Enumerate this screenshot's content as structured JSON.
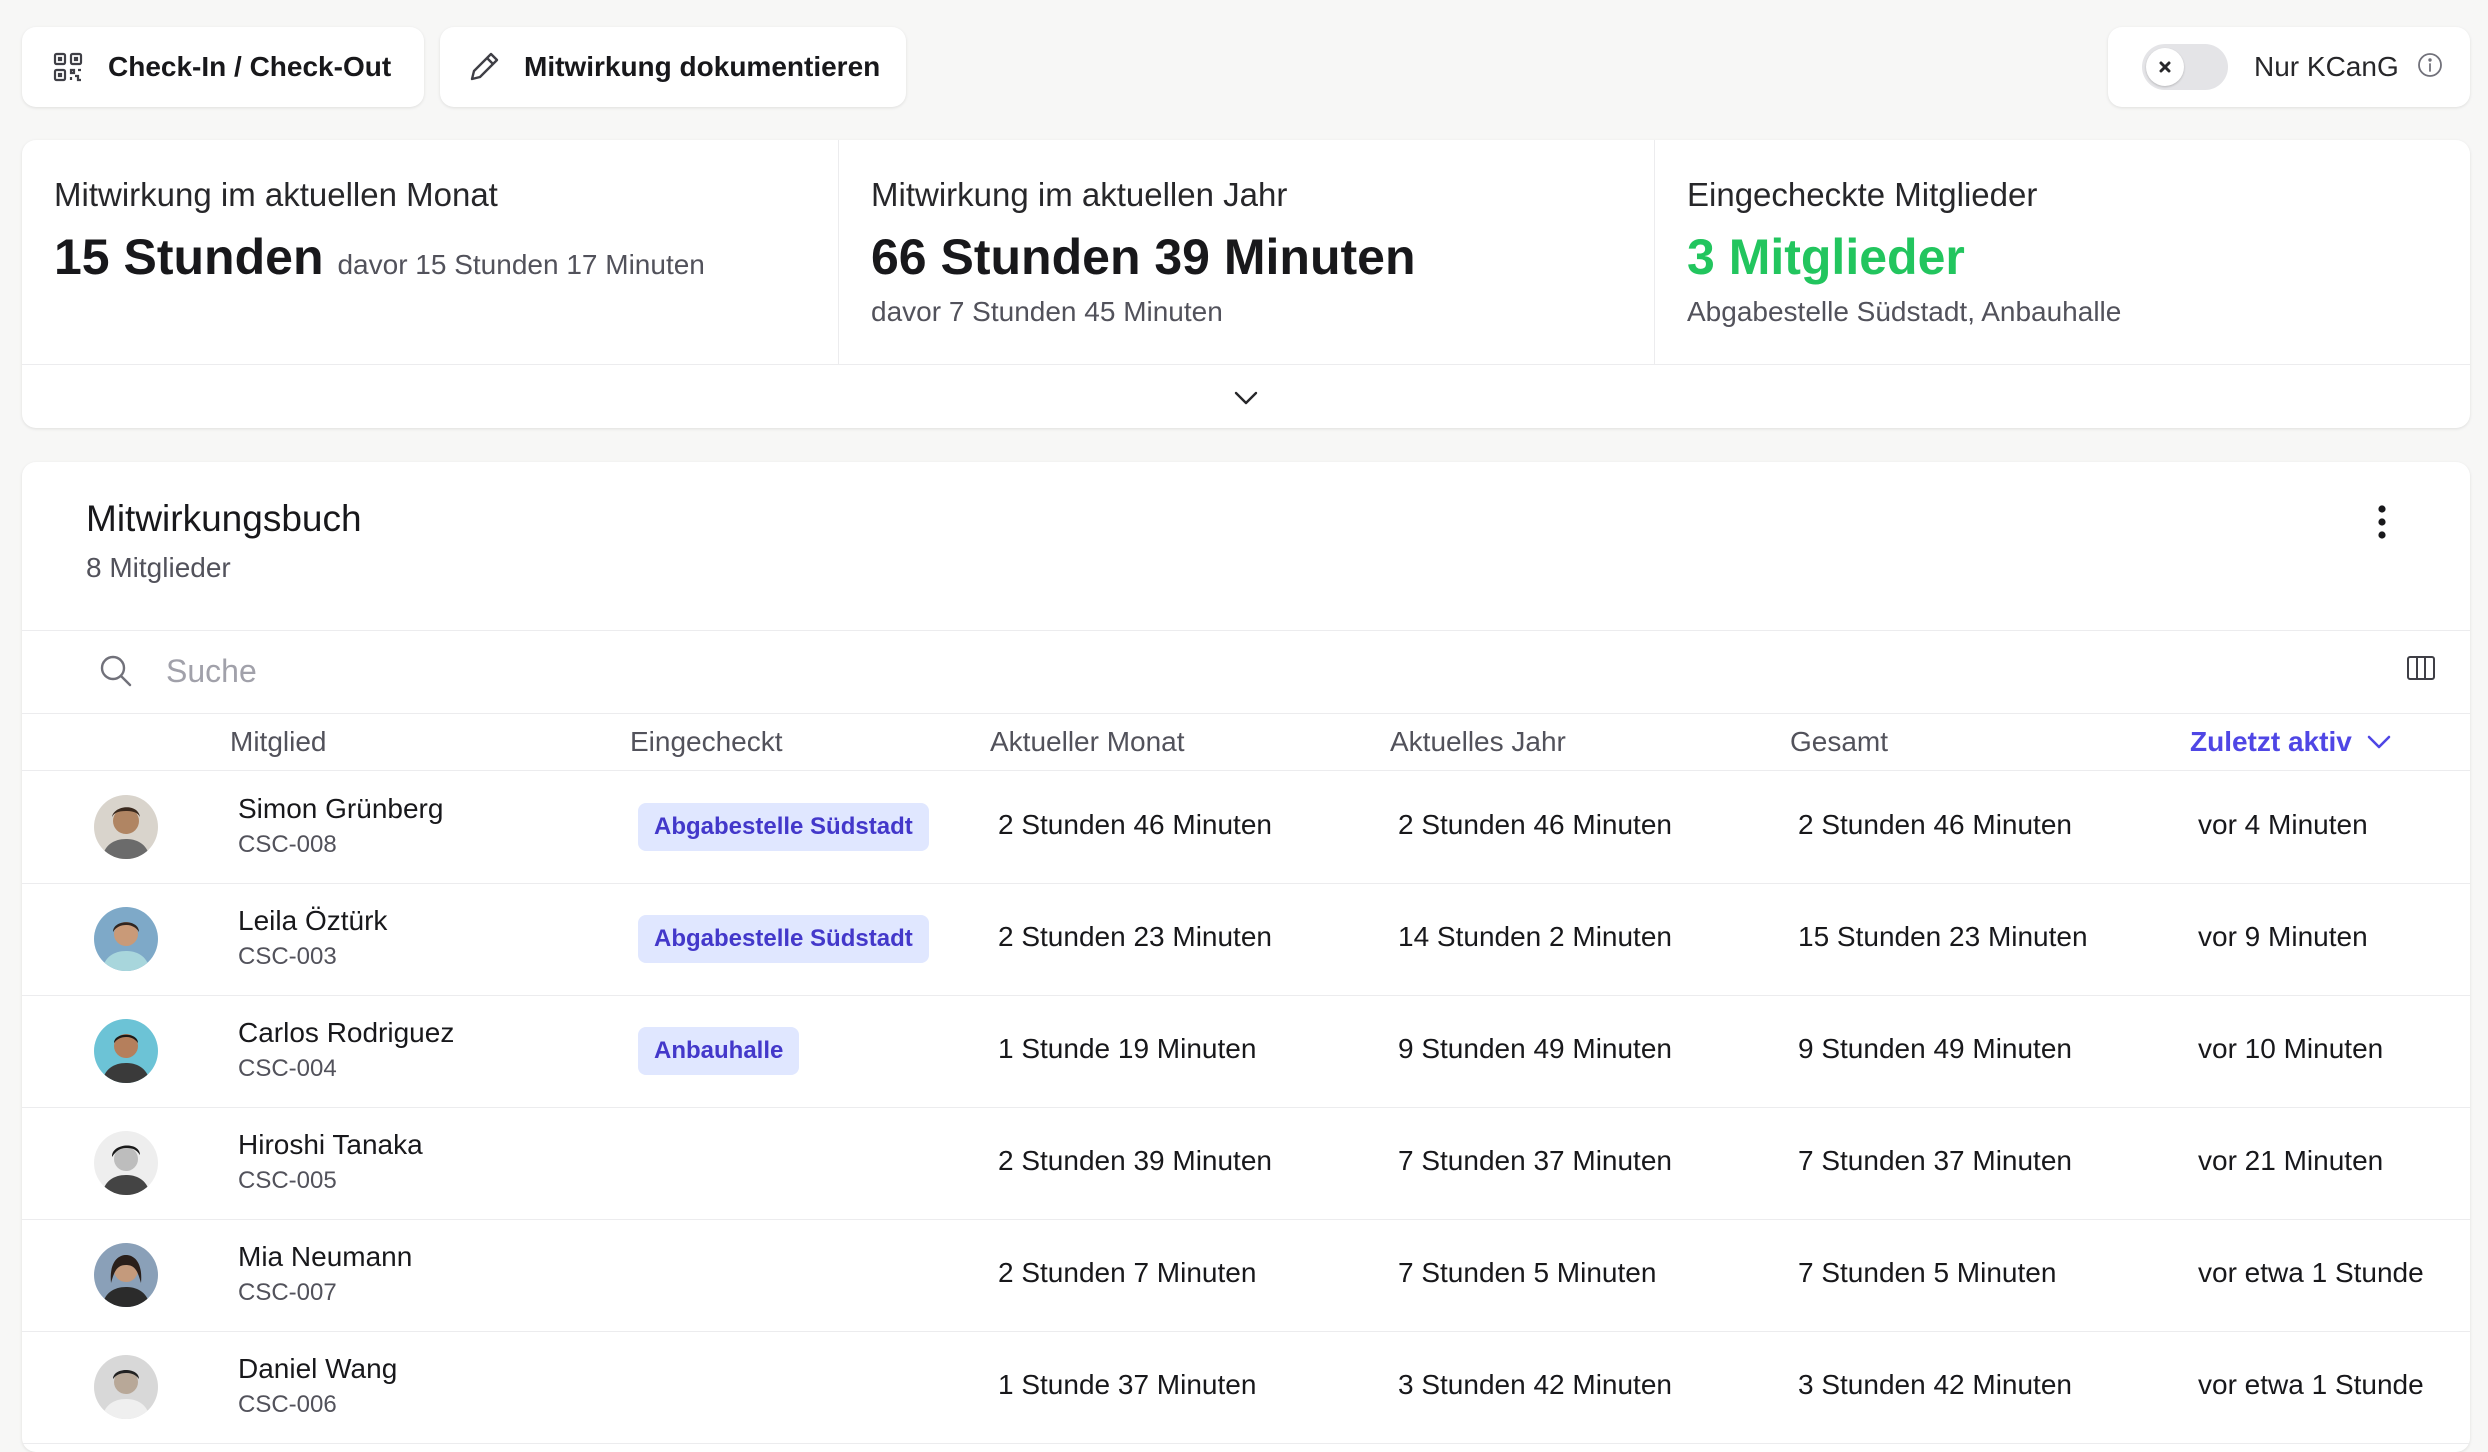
{
  "toolbar": {
    "checkin_label": "Check-In / Check-Out",
    "document_label": "Mitwirkung dokumentieren",
    "checkin_icon": "qr-code-icon",
    "document_icon": "pencil-icon"
  },
  "kcang_toggle": {
    "label": "Nur KCanG",
    "enabled": false,
    "info_icon": "info-icon"
  },
  "stats": {
    "month": {
      "title": "Mitwirkung im aktuellen Monat",
      "value": "15 Stunden",
      "sub": "davor 15 Stunden 17 Minuten"
    },
    "year": {
      "title": "Mitwirkung im aktuellen Jahr",
      "value": "66 Stunden 39 Minuten",
      "sub": "davor 7 Stunden 45 Minuten"
    },
    "checked_in": {
      "title": "Eingecheckte Mitglieder",
      "value": "3 Mitglieder",
      "sub": "Abgabestelle Südstadt, Anbauhalle",
      "color": "#22c55e"
    }
  },
  "book": {
    "title": "Mitwirkungsbuch",
    "subtitle": "8 Mitglieder",
    "search_placeholder": "Suche",
    "search_value": "",
    "columns": {
      "member": "Mitglied",
      "checked_in": "Eingecheckt",
      "month": "Aktueller Monat",
      "year": "Aktuelles Jahr",
      "total": "Gesamt",
      "last_active": "Zuletzt aktiv"
    },
    "sort_color": "#4f46e5",
    "rows": [
      {
        "name": "Simon Grünberg",
        "id": "CSC-008",
        "location": "Abgabestelle Südstadt",
        "month": "2 Stunden 46 Minuten",
        "year": "2 Stunden 46 Minuten",
        "total": "2 Stunden 46 Minuten",
        "last": "vor 4 Minuten"
      },
      {
        "name": "Leila Öztürk",
        "id": "CSC-003",
        "location": "Abgabestelle Südstadt",
        "month": "2 Stunden 23 Minuten",
        "year": "14 Stunden 2 Minuten",
        "total": "15 Stunden 23 Minuten",
        "last": "vor 9 Minuten"
      },
      {
        "name": "Carlos Rodriguez",
        "id": "CSC-004",
        "location": "Anbauhalle",
        "month": "1 Stunde 19 Minuten",
        "year": "9 Stunden 49 Minuten",
        "total": "9 Stunden 49 Minuten",
        "last": "vor 10 Minuten"
      },
      {
        "name": "Hiroshi Tanaka",
        "id": "CSC-005",
        "location": "",
        "month": "2 Stunden 39 Minuten",
        "year": "7 Stunden 37 Minuten",
        "total": "7 Stunden 37 Minuten",
        "last": "vor 21 Minuten"
      },
      {
        "name": "Mia Neumann",
        "id": "CSC-007",
        "location": "",
        "month": "2 Stunden 7 Minuten",
        "year": "7 Stunden 5 Minuten",
        "total": "7 Stunden 5 Minuten",
        "last": "vor etwa 1 Stunde"
      },
      {
        "name": "Daniel Wang",
        "id": "CSC-006",
        "location": "",
        "month": "1 Stunde 37 Minuten",
        "year": "3 Stunden 42 Minuten",
        "total": "3 Stunden 42 Minuten",
        "last": "vor etwa 1 Stunde"
      }
    ]
  }
}
